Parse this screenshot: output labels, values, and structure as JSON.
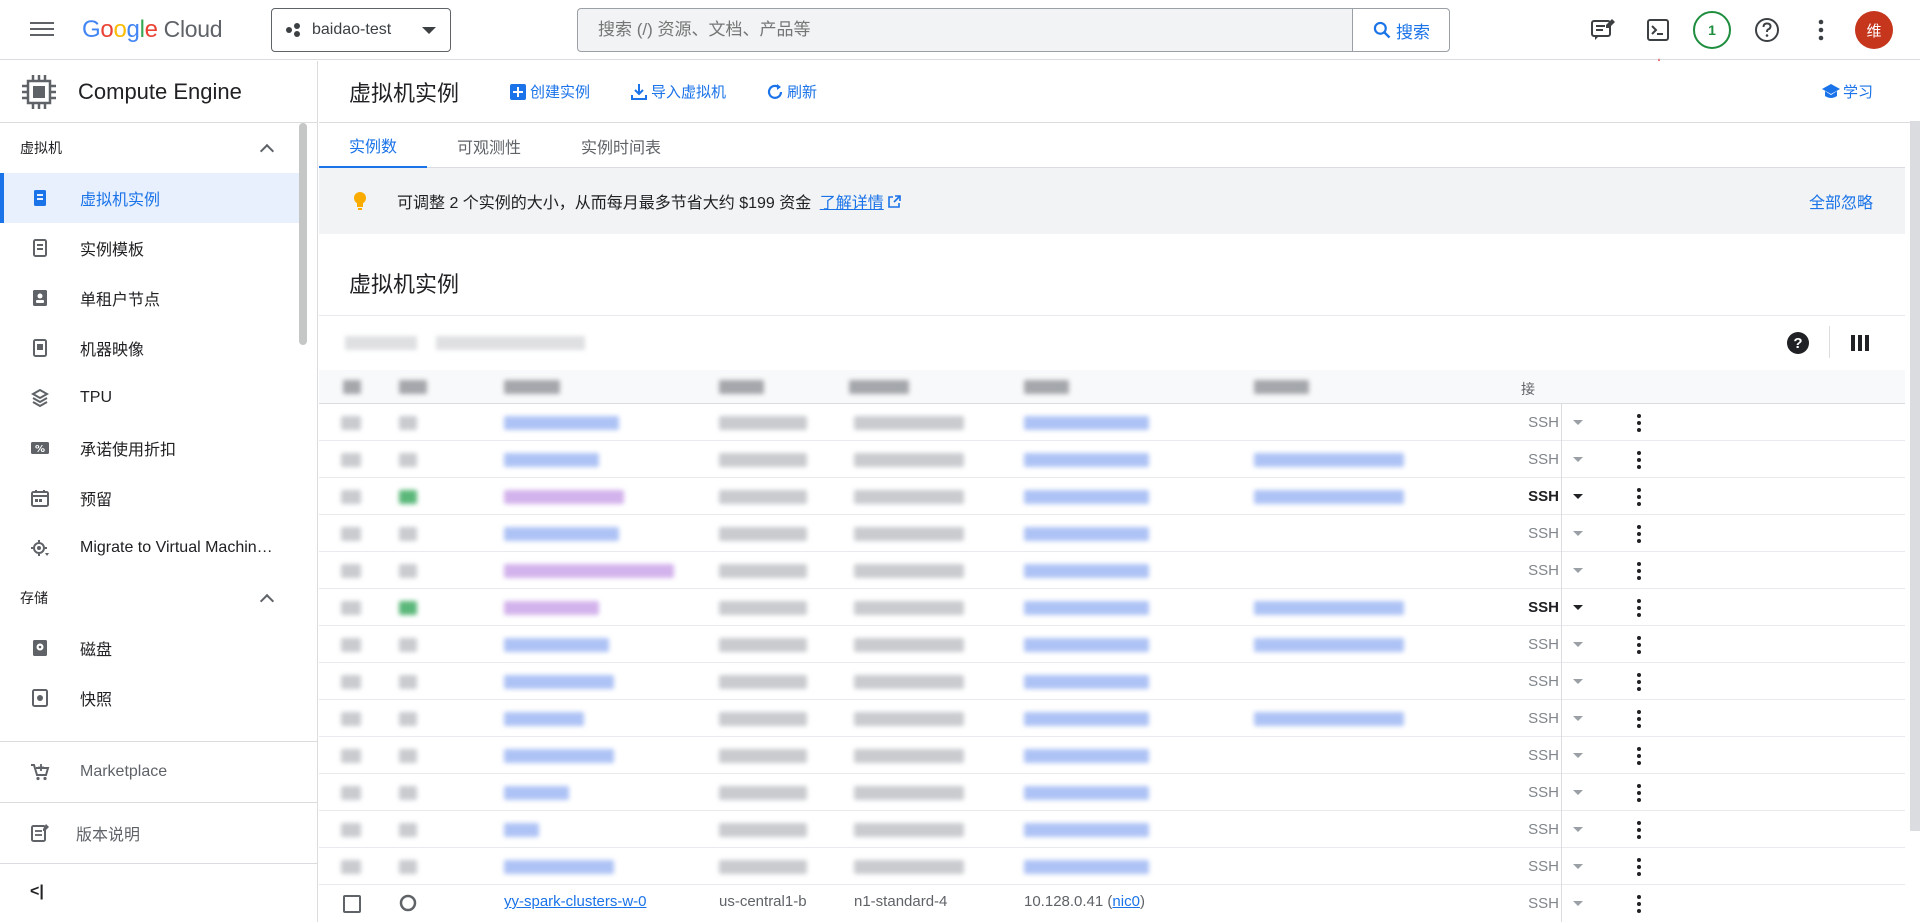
{
  "header": {
    "logo_google": "Google",
    "logo_cloud": "Cloud",
    "project_name": "baidao-test",
    "search_placeholder": "搜索 (/) 资源、文档、产品等",
    "search_button": "搜索",
    "notification_count": "1",
    "avatar_initial": "维"
  },
  "sidebar": {
    "product_title": "Compute Engine",
    "sections": [
      {
        "label": "虚拟机",
        "items": [
          {
            "label": "虚拟机实例",
            "icon": "vm-instance-icon",
            "active": true
          },
          {
            "label": "实例模板",
            "icon": "instance-template-icon"
          },
          {
            "label": "单租户节点",
            "icon": "sole-tenant-node-icon"
          },
          {
            "label": "机器映像",
            "icon": "machine-image-icon"
          },
          {
            "label": "TPU",
            "icon": "tpu-icon"
          },
          {
            "label": "承诺使用折扣",
            "icon": "percent-icon"
          },
          {
            "label": "预留",
            "icon": "calendar-icon"
          },
          {
            "label": "Migrate to Virtual Machin…",
            "icon": "migrate-icon"
          }
        ]
      },
      {
        "label": "存储",
        "items": [
          {
            "label": "磁盘",
            "icon": "disk-icon"
          },
          {
            "label": "快照",
            "icon": "snapshot-icon"
          }
        ]
      }
    ],
    "marketplace": "Marketplace",
    "release_notes": "版本说明",
    "collapse_label": "<|"
  },
  "main": {
    "page_title": "虚拟机实例",
    "actions": {
      "create": "创建实例",
      "import": "导入虚拟机",
      "refresh": "刷新",
      "learn": "学习"
    },
    "tabs": [
      "实例数",
      "可观测性",
      "实例时间表"
    ],
    "banner": {
      "message": "可调整 2 个实例的大小，从而每月最多节省大约 $199 资金",
      "link": "了解详情",
      "dismiss": "全部忽略"
    },
    "section_title": "虚拟机实例",
    "table": {
      "connect_header": "接",
      "ssh_label": "SSH",
      "last_row": {
        "name": "yy-spark-clusters-w-0",
        "zone": "us-central1-b",
        "machine": "n1-standard-4",
        "ip": "10.128.0.41",
        "nic": "nic0"
      }
    }
  },
  "colors": {
    "accent": "#1a73e8",
    "avatar_bg": "#c5361d",
    "badge_green": "#1e8e3e",
    "arrow_red": "#e8232b"
  }
}
